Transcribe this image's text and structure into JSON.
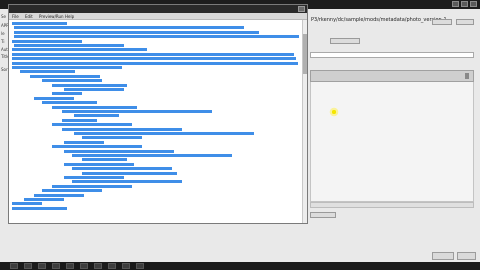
{
  "background_app": {
    "left_labels": [
      "Se",
      "APR",
      "le",
      "Ti",
      "Auth",
      "Title",
      "Sort"
    ],
    "file_path": "P3/rkenny/dc/sample/mods/metadata/photo_version-1",
    "status_text": ""
  },
  "editor": {
    "title": "",
    "menus": [
      "File",
      "Edit",
      "Preview/Run",
      "Help"
    ]
  },
  "taskbar": {
    "items": 10,
    "clock": ""
  },
  "icons": {
    "cursor": "cursor-highlight-icon",
    "close": "close-icon"
  },
  "colors": {
    "selection": "#3f8ee8",
    "taskbar": "#1a1a1a",
    "cursor_highlight": "#f5e600"
  }
}
